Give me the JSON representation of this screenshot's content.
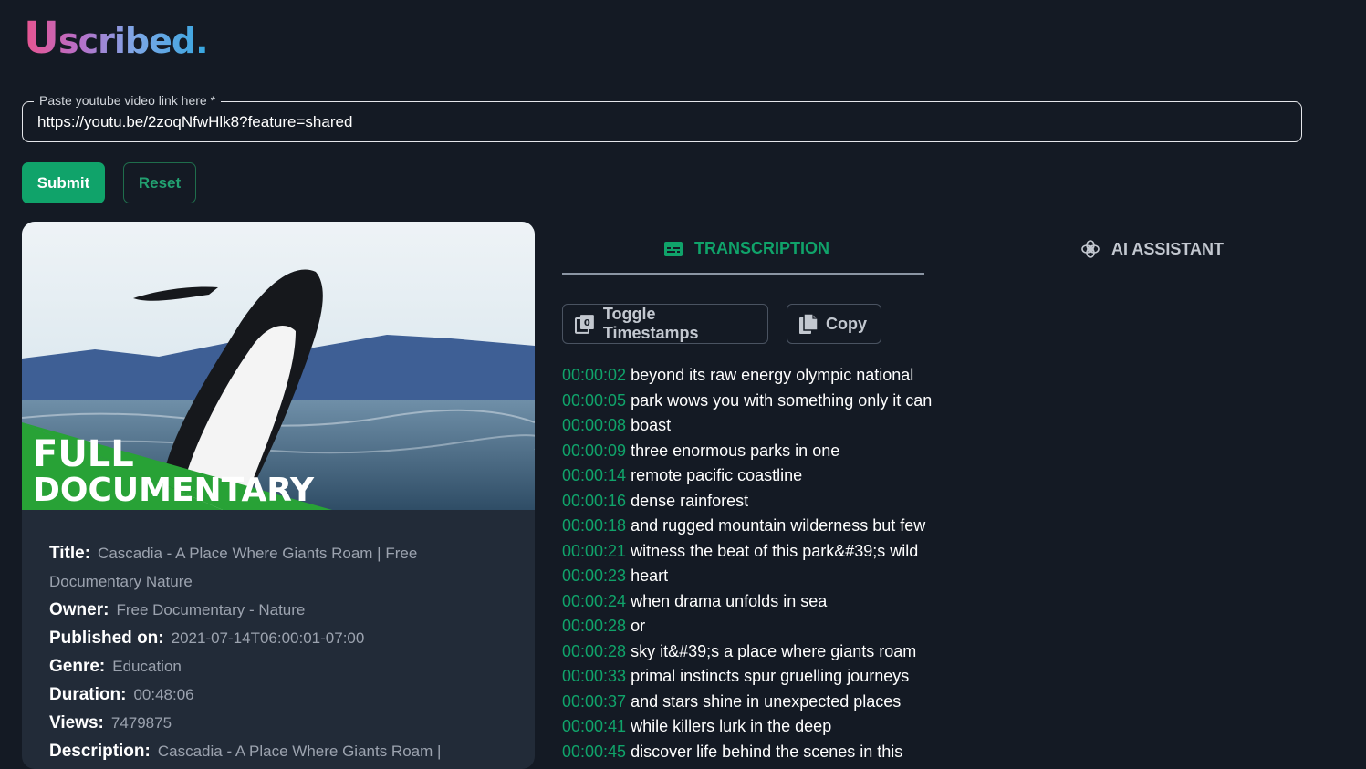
{
  "logo": {
    "first": "U",
    "rest": "scribed."
  },
  "url_field": {
    "label": "Paste youtube video link here *",
    "value": "https://youtu.be/2zoqNfwHlk8?feature=shared"
  },
  "buttons": {
    "submit": "Submit",
    "reset": "Reset"
  },
  "thumbnail": {
    "line1": "FULL",
    "line2": "DOCUMENTARY"
  },
  "video": {
    "title_key": "Title:",
    "title": "Cascadia - A Place Where Giants Roam | Free Documentary Nature",
    "owner_key": "Owner:",
    "owner": "Free Documentary - Nature",
    "published_key": "Published on:",
    "published": "2021-07-14T06:00:01-07:00",
    "genre_key": "Genre:",
    "genre": "Education",
    "duration_key": "Duration:",
    "duration": "00:48:06",
    "views_key": "Views:",
    "views": "7479875",
    "description_key": "Description:",
    "description": "Cascadia - A Place Where Giants Roam |"
  },
  "tabs": {
    "transcription": "TRANSCRIPTION",
    "ai_assistant": "AI ASSISTANT"
  },
  "tools": {
    "toggle": "Toggle Timestamps",
    "copy": "Copy"
  },
  "transcript": [
    {
      "ts": "00:00:02",
      "text": "beyond its raw energy olympic national"
    },
    {
      "ts": "00:00:05",
      "text": "park wows you with something only it can"
    },
    {
      "ts": "00:00:08",
      "text": "boast"
    },
    {
      "ts": "00:00:09",
      "text": "three enormous parks in one"
    },
    {
      "ts": "00:00:14",
      "text": "remote pacific coastline"
    },
    {
      "ts": "00:00:16",
      "text": "dense rainforest"
    },
    {
      "ts": "00:00:18",
      "text": "and rugged mountain wilderness but few"
    },
    {
      "ts": "00:00:21",
      "text": "witness the beat of this park&#39;s wild"
    },
    {
      "ts": "00:00:23",
      "text": "heart"
    },
    {
      "ts": "00:00:24",
      "text": "when drama unfolds in sea"
    },
    {
      "ts": "00:00:28",
      "text": "or"
    },
    {
      "ts": "00:00:28",
      "text": "sky it&#39;s a place where giants roam"
    },
    {
      "ts": "00:00:33",
      "text": "primal instincts spur gruelling journeys"
    },
    {
      "ts": "00:00:37",
      "text": "and stars shine in unexpected places"
    },
    {
      "ts": "00:00:41",
      "text": "while killers lurk in the deep"
    },
    {
      "ts": "00:00:45",
      "text": "discover life behind the scenes in this"
    }
  ],
  "colors": {
    "accent": "#10a36a",
    "background": "#141a24",
    "card": "#222b38"
  }
}
